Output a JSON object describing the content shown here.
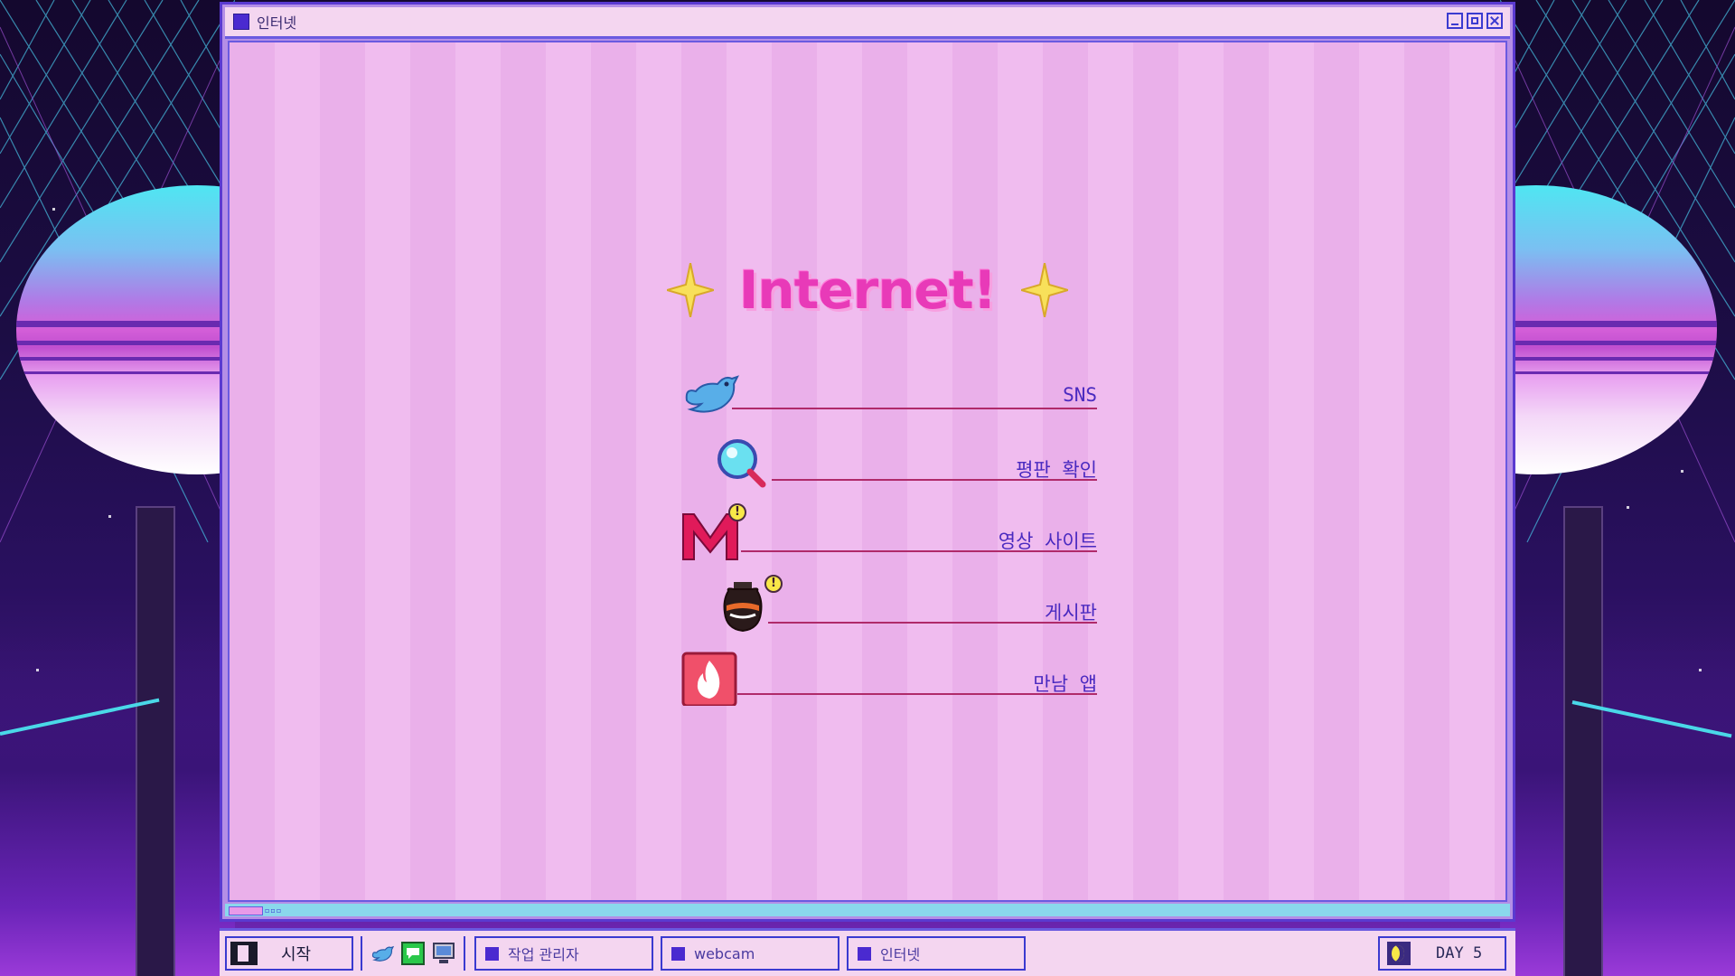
{
  "window": {
    "title": "인터넷",
    "buttons": [
      "minimize-icon",
      "maximize-icon",
      "close-icon"
    ]
  },
  "content": {
    "headline": "Internet!",
    "menu": [
      {
        "label": "SNS",
        "icon": "bird-icon"
      },
      {
        "label": "평판 확인",
        "icon": "magnifier-icon"
      },
      {
        "label": "영상 사이트",
        "icon": "m-logo-icon",
        "badge": "!"
      },
      {
        "label": "게시판",
        "icon": "jar-icon",
        "badge": "!"
      },
      {
        "label": "만남 앱",
        "icon": "flame-app-icon"
      }
    ]
  },
  "taskbar": {
    "start_label": "시작",
    "quick_launch": [
      "bird-icon",
      "chat-icon",
      "computer-icon"
    ],
    "tasks": [
      {
        "label": "작업 관리자"
      },
      {
        "label": "webcam"
      },
      {
        "label": "인터넷"
      }
    ],
    "tray": {
      "day_label": "DAY 5",
      "icon": "moon-icon"
    }
  },
  "colors": {
    "window_border": "#5a3ad0",
    "content_bg": "#eab0ea",
    "headline": "#e83ab8",
    "menu_line": "#b02a6a",
    "menu_text": "#4a2ac0",
    "taskbar_bg": "#f4d6f0"
  }
}
